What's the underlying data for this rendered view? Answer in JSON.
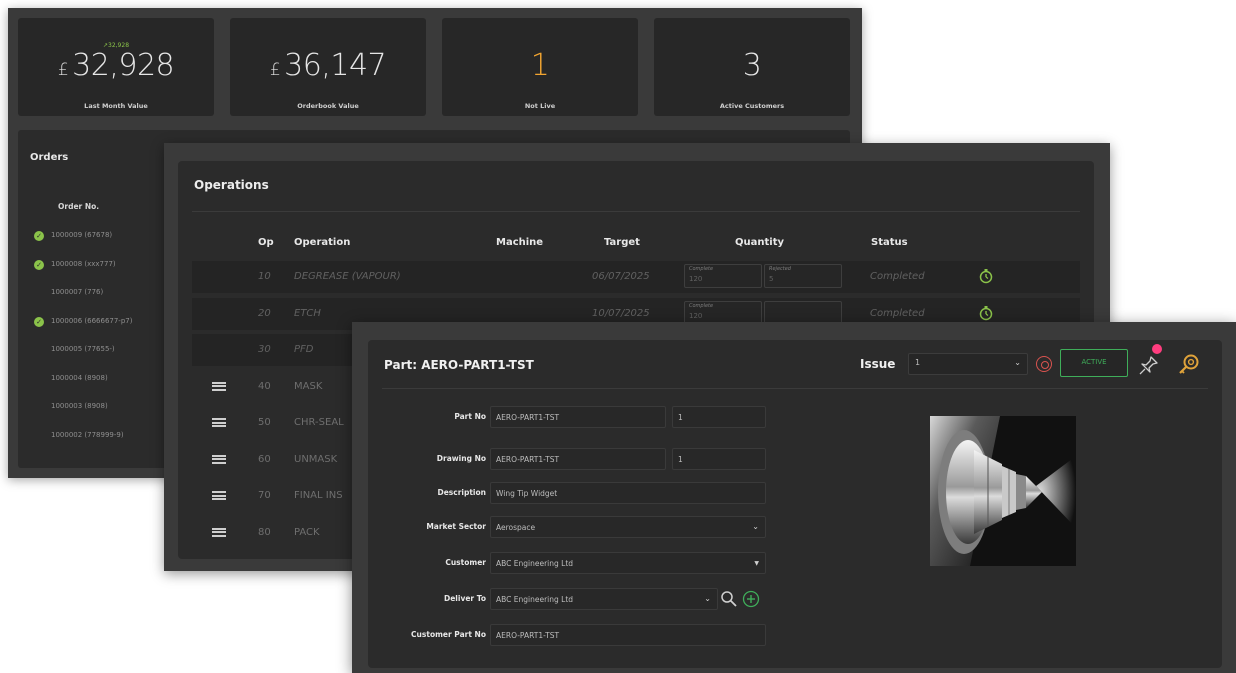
{
  "dashboard": {
    "kpis": [
      {
        "delta": "↗32,928",
        "currency": "£",
        "value": "32,928",
        "caption": "Last Month Value"
      },
      {
        "delta": "",
        "currency": "£",
        "value": "36,147",
        "caption": "Orderbook Value"
      },
      {
        "delta": "",
        "currency": "",
        "value": "1",
        "caption": "Not Live"
      },
      {
        "delta": "",
        "currency": "",
        "value": "3",
        "caption": "Active Customers"
      }
    ],
    "orders": {
      "title": "Orders",
      "column": "Order No.",
      "rows": [
        {
          "no": "1000009 (67678)",
          "checked": true
        },
        {
          "no": "1000008 (xxx777)",
          "checked": true
        },
        {
          "no": "1000007 (776)",
          "checked": false
        },
        {
          "no": "1000006 (6666677-p7)",
          "checked": true
        },
        {
          "no": "1000005 (77655-)",
          "checked": false
        },
        {
          "no": "1000004 (8908)",
          "checked": false
        },
        {
          "no": "1000003 (8908)",
          "checked": false
        },
        {
          "no": "1000002 (778999-9)",
          "checked": false
        }
      ]
    }
  },
  "operations": {
    "title": "Operations",
    "headers": {
      "op": "Op",
      "operation": "Operation",
      "machine": "Machine",
      "target": "Target",
      "quantity": "Quantity",
      "status": "Status"
    },
    "rows": [
      {
        "op": "10",
        "operation": "DEGREASE (VAPOUR)",
        "target": "06/07/2025",
        "complete_label": "Complete",
        "complete": "120",
        "rejected_label": "Rejected",
        "rejected": "5",
        "status": "Completed",
        "state": "done"
      },
      {
        "op": "20",
        "operation": "ETCH",
        "target": "10/07/2025",
        "complete_label": "Complete",
        "complete": "120",
        "rejected_label": "",
        "rejected": "",
        "status": "Completed",
        "state": "done"
      },
      {
        "op": "30",
        "operation": "PFD",
        "target": "",
        "complete_label": "",
        "complete": "",
        "rejected_label": "",
        "rejected": "",
        "status": "",
        "state": "done"
      },
      {
        "op": "40",
        "operation": "MASK",
        "target": "",
        "status": "",
        "state": "pending"
      },
      {
        "op": "50",
        "operation": "CHR-SEAL",
        "target": "",
        "status": "",
        "state": "pending"
      },
      {
        "op": "60",
        "operation": "UNMASK",
        "target": "",
        "status": "",
        "state": "pending"
      },
      {
        "op": "70",
        "operation": "FINAL INS",
        "target": "",
        "status": "",
        "state": "pending"
      },
      {
        "op": "80",
        "operation": "PACK",
        "target": "",
        "status": "",
        "state": "pending"
      }
    ]
  },
  "part": {
    "title": "Part: AERO-PART1-TST",
    "issue_label": "Issue",
    "issue_value": "1",
    "active_label": "ACTIVE",
    "fields": {
      "part_no": {
        "label": "Part No",
        "value": "AERO-PART1-TST",
        "rev": "1"
      },
      "drawing_no": {
        "label": "Drawing No",
        "value": "AERO-PART1-TST",
        "rev": "1"
      },
      "description": {
        "label": "Description",
        "value": "Wing Tip Widget"
      },
      "market_sector": {
        "label": "Market Sector",
        "value": "Aerospace"
      },
      "customer": {
        "label": "Customer",
        "value": "ABC Engineering Ltd"
      },
      "deliver_to": {
        "label": "Deliver To",
        "value": "ABC Engineering Ltd"
      },
      "customer_part_no": {
        "label": "Customer Part No",
        "value": "AERO-PART1-TST"
      }
    }
  },
  "colors": {
    "accent_green": "#8bc34a",
    "orange": "#f2a531",
    "active_green": "#3fae5a",
    "alert_red": "#d9534f",
    "badge_pink": "#ff3d7f"
  },
  "icons": [
    "check-icon",
    "drag-handle-icon",
    "stopwatch-icon",
    "chevron-down-icon",
    "search-icon",
    "add-circle-icon",
    "pin-icon",
    "key-search-icon"
  ]
}
